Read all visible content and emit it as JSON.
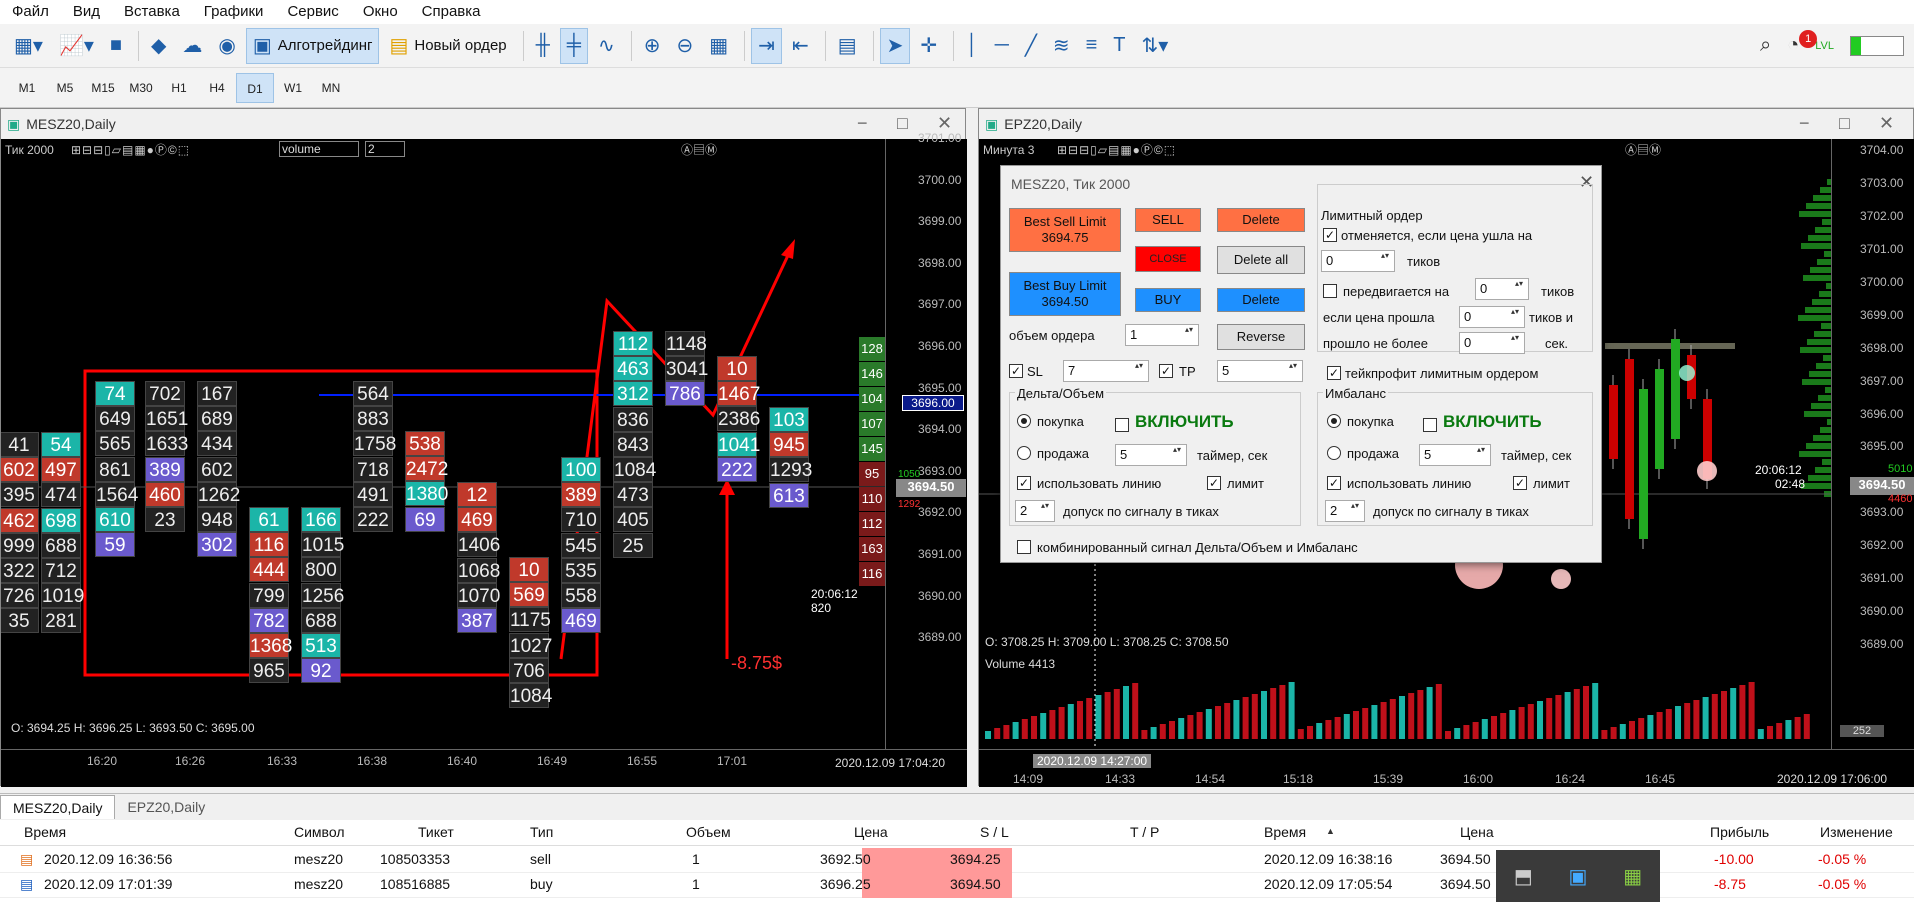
{
  "menu": [
    "Файл",
    "Вид",
    "Вставка",
    "Графики",
    "Сервис",
    "Окно",
    "Справка"
  ],
  "toolbar": {
    "algo": "Алготрейдинг",
    "new_order": "Новый ордер",
    "notif_count": "1",
    "lvl": "LVL"
  },
  "timeframes": [
    "M1",
    "M5",
    "M15",
    "M30",
    "H1",
    "H4",
    "D1",
    "W1",
    "MN"
  ],
  "timeframe_selected": "D1",
  "left_chart": {
    "title": "MESZ20,Daily",
    "tick_label": "Тик",
    "tick_value": "2000",
    "indicator": "volume",
    "indicator_param": "2",
    "price_labels": [
      "3701.00",
      "3700.00",
      "3699.00",
      "3698.00",
      "3697.00",
      "3696.00",
      "3695.00",
      "3694.00",
      "3693.00",
      "3692.00",
      "3691.00",
      "3690.00",
      "3689.00"
    ],
    "current_line": "3696.00",
    "bid_price": "3694.50",
    "ohlc": "O: 3694.25  H: 3696.25  L: 3693.50  C: 3695.00",
    "time_left": "20:06:12",
    "vol_left": "820",
    "side_vol": [
      "128",
      "146",
      "104",
      "107",
      "145",
      "95",
      "110",
      "112",
      "163",
      "116"
    ],
    "sum_green": "1050",
    "sum_red": "1292",
    "time_labels": [
      "16:20",
      "16:26",
      "16:33",
      "16:38",
      "16:40",
      "16:49",
      "16:55",
      "17:01"
    ],
    "date": "2020.12.09 17:04:20",
    "annotation": "-8.75$"
  },
  "right_chart": {
    "title": "EPZ20,Daily",
    "tf_label": "Минута",
    "tf_value": "3",
    "price_labels": [
      "3704.00",
      "3703.00",
      "3702.00",
      "3701.00",
      "3700.00",
      "3699.00",
      "3698.00",
      "3697.00",
      "3696.00",
      "3695.00",
      "3694.50",
      "3693.00",
      "3692.00",
      "3691.00",
      "3690.00",
      "3689.00"
    ],
    "ohlc": "O: 3708.25  H: 3709.00  L: 3708.25  C: 3708.50",
    "volume_label": "Volume 4413",
    "vol_val": "252",
    "time_labels": [
      "14:09",
      "14:33",
      "14:54",
      "15:18",
      "15:39",
      "16:00",
      "16:24",
      "16:45"
    ],
    "date": "2020.12.09 17:06:00",
    "crosshair_date": "2020.12.09 14:27:00",
    "countdown": "20:06:12",
    "countdown2": "02:48",
    "sum_green": "5010",
    "sum_red": "4460"
  },
  "dialog": {
    "title": "MESZ20, Тик  2000",
    "best_sell_label": "Best Sell Limit",
    "best_sell_price": "3694.75",
    "best_buy_label": "Best Buy Limit",
    "best_buy_price": "3694.50",
    "sell": "SELL",
    "close": "CLOSE",
    "buy": "BUY",
    "delete1": "Delete",
    "delete_all": "Delete all",
    "delete2": "Delete",
    "reverse": "Reverse",
    "vol_label": "объем ордера",
    "vol_value": "1",
    "sl": "SL",
    "sl_value": "7",
    "tp": "TP",
    "tp_value": "5",
    "limit_title": "Лимитный ордер",
    "cancel_if": "отменяется, если цена ушла на",
    "cancel_ticks": "0",
    "ticks": "тиков",
    "move_by": "передвигается на",
    "move_ticks": "0",
    "ticks2": "тиков",
    "if_price": "если цена прошла",
    "if_ticks": "0",
    "ticks_and": "тиков и",
    "passed": "прошло не более",
    "passed_val": "0",
    "sec": "сек.",
    "tp_limit": "тейкпрофит лимитным ордером",
    "delta_title": "Дельта/Объем",
    "imb_title": "Имбаланс",
    "buy_r": "покупка",
    "sell_r": "продажа",
    "enable": "ВКЛЮЧИТЬ",
    "timer_val": "5",
    "timer": "таймер, сек",
    "use_line": "использовать линию",
    "limit": "лимит",
    "tol_val": "2",
    "tolerance": "допуск по сигналу в тиках",
    "combined": "комбинированный сигнал Дельта/Объем и Имбаланс"
  },
  "tabs": [
    "MESZ20,Daily",
    "EPZ20,Daily"
  ],
  "trade_headers": [
    "Время",
    "Символ",
    "Тикет",
    "Тип",
    "Объем",
    "Цена",
    "S / L",
    "T / P",
    "Время",
    "Цена",
    "Прибыль",
    "Изменение"
  ],
  "trades": [
    [
      "2020.12.09 16:36:56",
      "mesz20",
      "108503353",
      "sell",
      "1",
      "3692.50",
      "3694.25",
      "",
      "2020.12.09 16:38:16",
      "3694.50",
      "-10.00",
      "-0.05 %"
    ],
    [
      "2020.12.09 17:01:39",
      "mesz20",
      "108516885",
      "buy",
      "1",
      "3696.25",
      "3694.50",
      "",
      "2020.12.09 17:05:54",
      "3694.50",
      "-8.75",
      "-0.05 %"
    ]
  ],
  "colors": {
    "sell": "#ff7043",
    "buy": "#1e90ff",
    "close": "#ff0000",
    "green_cell": "#1bb5a8",
    "red_cell": "#c0392b",
    "purple_cell": "#6a5acd"
  }
}
